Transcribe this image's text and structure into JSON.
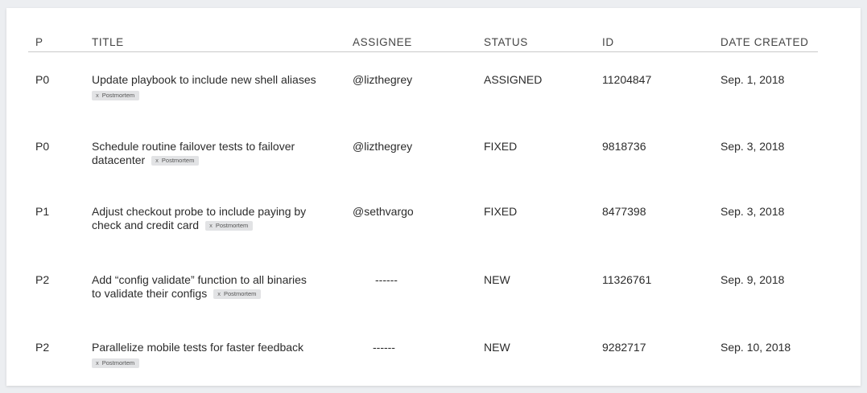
{
  "table": {
    "headers": {
      "p": "P",
      "title": "TITLE",
      "assignee": "ASSIGNEE",
      "status": "STATUS",
      "id": "ID",
      "date": "DATE CREATED"
    },
    "rows": [
      {
        "priority": "P0",
        "title_line1": "Update playbook to include new shell aliases",
        "title_line2": "",
        "chip_x": "x",
        "chip_label": "Postmortem",
        "assignee": "@lizthegrey",
        "status": "ASSIGNED",
        "id": "11204847",
        "date": "Sep. 1, 2018"
      },
      {
        "priority": "P0",
        "title_line1": "Schedule routine failover tests to failover",
        "title_line2": "datacenter",
        "chip_x": "x",
        "chip_label": "Postmortem",
        "assignee": "@lizthegrey",
        "status": "FIXED",
        "id": "9818736",
        "date": "Sep. 3, 2018"
      },
      {
        "priority": "P1",
        "title_line1": "Adjust checkout probe to include paying by",
        "title_line2": "check and credit card",
        "chip_x": "x",
        "chip_label": "Postmortem",
        "assignee": "@sethvargo",
        "status": "FIXED",
        "id": "8477398",
        "date": "Sep. 3, 2018"
      },
      {
        "priority": "P2",
        "title_line1": "Add “config validate” function to all binaries",
        "title_line2": "to validate their configs",
        "chip_x": "x",
        "chip_label": "Postmortem",
        "assignee": "------",
        "status": "NEW",
        "id": "11326761",
        "date": "Sep. 9, 2018"
      },
      {
        "priority": "P2",
        "title_line1": "Parallelize mobile tests for faster feedback",
        "title_line2": "",
        "chip_x": "x",
        "chip_label": "Postmortem",
        "assignee": "------",
        "status": "NEW",
        "id": "9282717",
        "date": "Sep. 10, 2018"
      }
    ]
  }
}
